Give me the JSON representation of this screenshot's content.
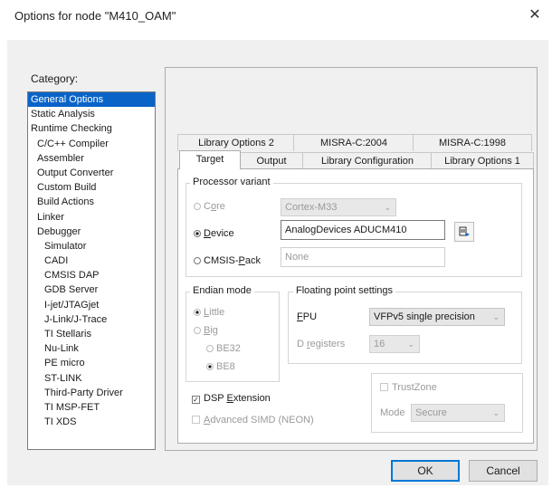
{
  "window": {
    "title": "Options for node \"M410_OAM\"",
    "close_glyph": "✕"
  },
  "category": {
    "label": "Category:",
    "items": [
      {
        "label": "General Options",
        "level": 0,
        "selected": true
      },
      {
        "label": "Static Analysis",
        "level": 0
      },
      {
        "label": "Runtime Checking",
        "level": 0
      },
      {
        "label": "C/C++ Compiler",
        "level": 1
      },
      {
        "label": "Assembler",
        "level": 1
      },
      {
        "label": "Output Converter",
        "level": 1
      },
      {
        "label": "Custom Build",
        "level": 1
      },
      {
        "label": "Build Actions",
        "level": 1
      },
      {
        "label": "Linker",
        "level": 1
      },
      {
        "label": "Debugger",
        "level": 1
      },
      {
        "label": "Simulator",
        "level": 2
      },
      {
        "label": "CADI",
        "level": 2
      },
      {
        "label": "CMSIS DAP",
        "level": 2
      },
      {
        "label": "GDB Server",
        "level": 2
      },
      {
        "label": "I-jet/JTAGjet",
        "level": 2
      },
      {
        "label": "J-Link/J-Trace",
        "level": 2
      },
      {
        "label": "TI Stellaris",
        "level": 2
      },
      {
        "label": "Nu-Link",
        "level": 2
      },
      {
        "label": "PE micro",
        "level": 2
      },
      {
        "label": "ST-LINK",
        "level": 2
      },
      {
        "label": "Third-Party Driver",
        "level": 2
      },
      {
        "label": "TI MSP-FET",
        "level": 2
      },
      {
        "label": "TI XDS",
        "level": 2
      }
    ]
  },
  "tabs": {
    "row_back": [
      "Library Options 2",
      "MISRA-C:2004",
      "MISRA-C:1998"
    ],
    "row_front": [
      "Target",
      "Output",
      "Library Configuration",
      "Library Options 1"
    ],
    "active": "Target"
  },
  "processor": {
    "group_label": "Processor variant",
    "core": {
      "label_pre": "C",
      "label_u": "o",
      "label_post": "re",
      "value": "Cortex-M33",
      "checked": false
    },
    "device": {
      "label_pre": "",
      "label_u": "D",
      "label_post": "evice",
      "value": "AnalogDevices ADUCM410",
      "checked": true
    },
    "cmsis": {
      "label_pre": "CMSIS-",
      "label_u": "P",
      "label_post": "ack",
      "value": "None",
      "checked": false
    }
  },
  "endian": {
    "group_label": "Endian mode",
    "little": {
      "label_u": "L",
      "label_post": "ittle"
    },
    "big": {
      "label_u": "B",
      "label_post": "ig"
    },
    "be32": "BE32",
    "be8": "BE8"
  },
  "fpu": {
    "group_label": "Floating point settings",
    "fpu_label_u": "F",
    "fpu_label_post": "PU",
    "fpu_value": "VFPv5 single precision",
    "dreg_label_pre": "D ",
    "dreg_label_u": "r",
    "dreg_label_post": "egisters",
    "dreg_value": "16"
  },
  "trustzone": {
    "label": "TrustZone",
    "mode_label": "Mode",
    "mode_value": "Secure"
  },
  "dsp": {
    "label_pre": "DSP ",
    "label_u": "E",
    "label_post": "xtension",
    "checked": true
  },
  "simd": {
    "label_u": "A",
    "label_post": "dvanced SIMD (NEON)"
  },
  "buttons": {
    "ok": "OK",
    "cancel": "Cancel"
  }
}
